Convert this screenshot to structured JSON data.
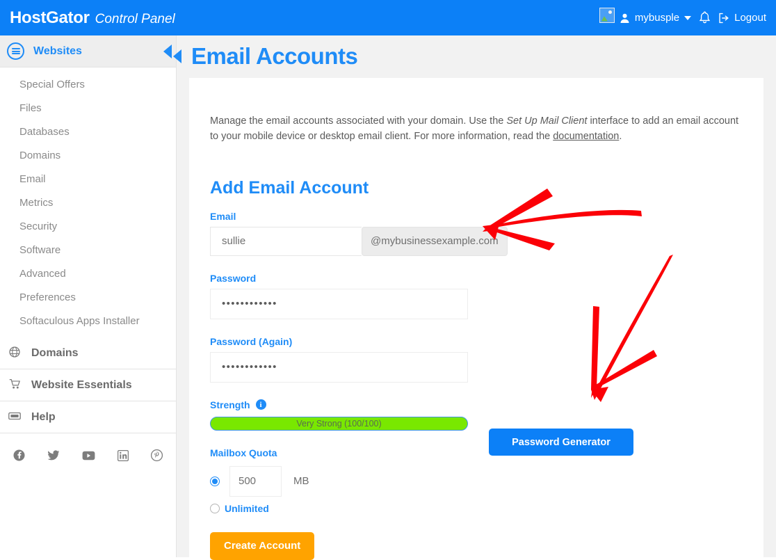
{
  "header": {
    "brand_name": "HostGator",
    "brand_subtitle": "Control Panel",
    "avatar_icon": "broken-image-icon",
    "user_icon": "person-icon",
    "username": "mybusple",
    "bell_icon": "bell-icon",
    "logout_icon": "logout-icon",
    "logout_label": "Logout"
  },
  "sidebar": {
    "websites": {
      "icon": "server-icon",
      "label": "Websites",
      "collapse_icon": "collapse-left-icon",
      "items": [
        {
          "label": "Special Offers"
        },
        {
          "label": "Files"
        },
        {
          "label": "Databases"
        },
        {
          "label": "Domains"
        },
        {
          "label": "Email"
        },
        {
          "label": "Metrics"
        },
        {
          "label": "Security"
        },
        {
          "label": "Software"
        },
        {
          "label": "Advanced"
        },
        {
          "label": "Preferences"
        },
        {
          "label": "Softaculous Apps Installer"
        }
      ]
    },
    "groups": [
      {
        "icon": "globe-icon",
        "label": "Domains"
      },
      {
        "icon": "cart-icon",
        "label": "Website Essentials"
      },
      {
        "icon": "ticket-icon",
        "label": "Help"
      }
    ],
    "social": [
      {
        "name": "facebook-icon",
        "glyph": "f"
      },
      {
        "name": "twitter-icon",
        "glyph": "t"
      },
      {
        "name": "youtube-icon",
        "glyph": "y"
      },
      {
        "name": "linkedin-icon",
        "glyph": "in"
      },
      {
        "name": "pinterest-icon",
        "glyph": "p"
      }
    ]
  },
  "main": {
    "back_icon": "back-arrow-icon",
    "page_title": "Email Accounts",
    "description": {
      "part1": "Manage the email accounts associated with your domain. Use the ",
      "emphasis": "Set Up Mail Client",
      "part2": " interface to add an email account to your mobile device or desktop email client. For more information, read the ",
      "link": "documentation",
      "part3": "."
    },
    "form": {
      "section_title": "Add Email Account",
      "email_label": "Email",
      "email_value": "sullie",
      "email_placeholder": "",
      "email_domain": "@mybusinessexample.com",
      "password_label": "Password",
      "password_value": "••••••••••••",
      "password_again_label": "Password (Again)",
      "password_again_value": "••••••••••••",
      "strength_label": "Strength",
      "strength_info_icon": "info-icon",
      "strength_info_glyph": "i",
      "strength_text": "Very Strong (100/100)",
      "strength_percent": 100,
      "strength_color": "#79e800",
      "quota_label": "Mailbox Quota",
      "quota_value": "500",
      "quota_unit": "MB",
      "quota_selected": "fixed",
      "unlimited_label": "Unlimited",
      "create_label": "Create Account",
      "create_color": "#ffa300",
      "password_generator_label": "Password Generator",
      "password_generator_color": "#0c80f7"
    }
  },
  "annotations": {
    "color": "#fb0007",
    "arrows": [
      {
        "name": "arrow-to-email-domain",
        "target": "email-domain-addon"
      },
      {
        "name": "arrow-to-password-generator",
        "target": "password-generator-button"
      }
    ]
  }
}
